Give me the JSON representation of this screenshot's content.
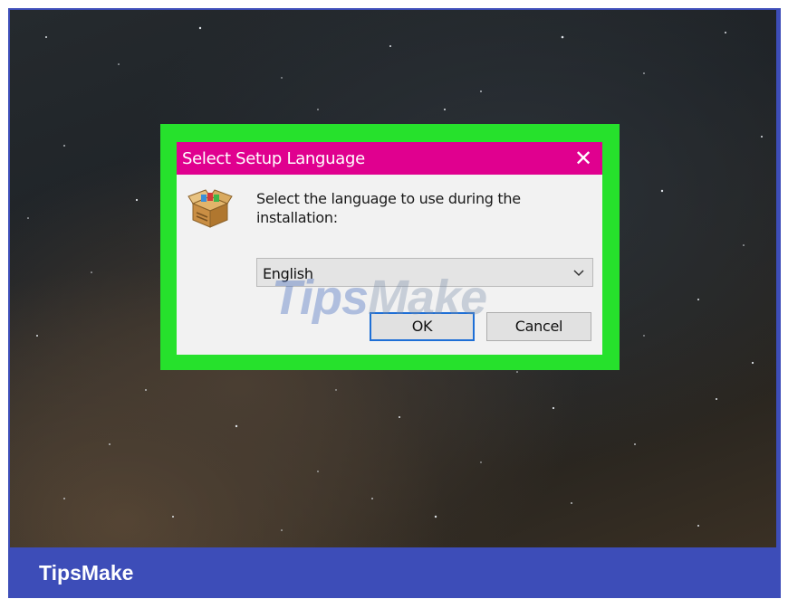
{
  "dialog": {
    "title": "Select Setup Language",
    "close_glyph": "✕",
    "prompt": "Select the language to use during the installation:",
    "language_select": {
      "value": "English"
    },
    "ok_label": "OK",
    "cancel_label": "Cancel",
    "icon": "setup-box-icon"
  },
  "watermark": {
    "left": "Tips",
    "right": "Make"
  },
  "footer": {
    "brand": "TipsMake"
  },
  "colors": {
    "frame": "#3d4db8",
    "highlight": "#26e12c",
    "titlebar": "#e0008f",
    "dialog_bg": "#f2f2f2",
    "ok_focus_border": "#1e6fd6"
  }
}
